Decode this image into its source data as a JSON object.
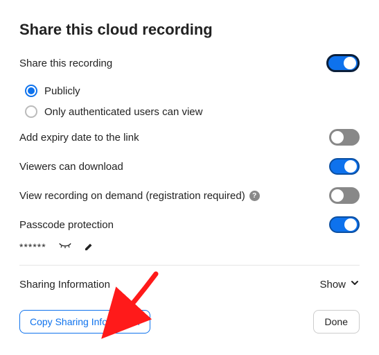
{
  "title": "Share this cloud recording",
  "share_recording": {
    "label": "Share this recording",
    "enabled": true,
    "options": {
      "publicly": "Publicly",
      "authenticated": "Only authenticated users can view",
      "selected": "publicly"
    }
  },
  "settings": {
    "expiry": {
      "label": "Add expiry date to the link",
      "enabled": false
    },
    "download": {
      "label": "Viewers can download",
      "enabled": true
    },
    "on_demand": {
      "label": "View recording on demand (registration required)",
      "enabled": false
    },
    "passcode": {
      "label": "Passcode protection",
      "enabled": true,
      "masked": "******"
    }
  },
  "sharing_info": {
    "label": "Sharing Information",
    "toggle_label": "Show"
  },
  "buttons": {
    "copy": "Copy Sharing Information",
    "done": "Done"
  }
}
